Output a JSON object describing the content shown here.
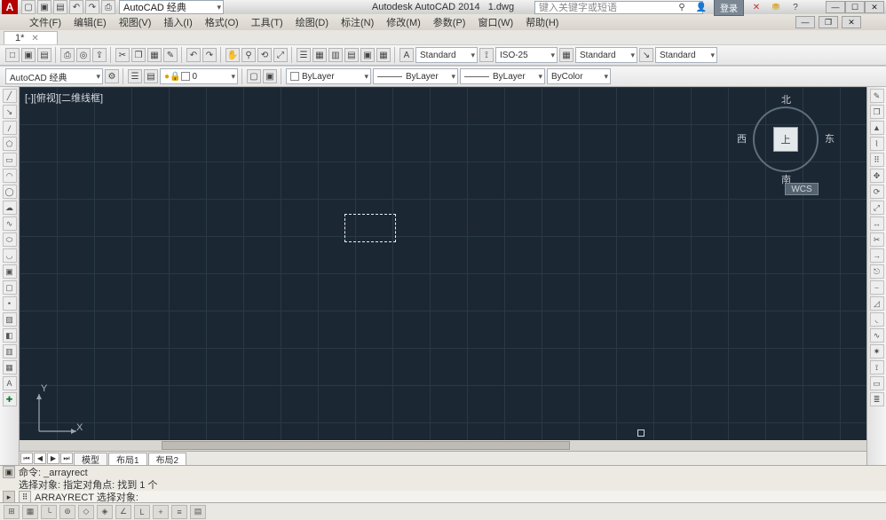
{
  "title_app": "Autodesk AutoCAD 2014",
  "title_doc": "1.dwg",
  "workspace_sel": "AutoCAD 经典",
  "search_placeholder": "键入关键字或短语",
  "login": "登录",
  "menu": [
    "文件(F)",
    "编辑(E)",
    "视图(V)",
    "插入(I)",
    "格式(O)",
    "工具(T)",
    "绘图(D)",
    "标注(N)",
    "修改(M)",
    "参数(P)",
    "窗口(W)",
    "帮助(H)"
  ],
  "doc_tab": "1*",
  "row1": {
    "style1": "Standard",
    "style2": "ISO-25",
    "style3": "Standard",
    "style4": "Standard"
  },
  "row2": {
    "workspace": "AutoCAD 经典",
    "layer": "0",
    "color": "ByLayer",
    "ltype": "ByLayer",
    "lweight": "ByLayer",
    "plot": "ByColor"
  },
  "view_label": "[-][俯视][二维线框]",
  "compass": {
    "n": "北",
    "s": "南",
    "e": "东",
    "w": "西",
    "top": "上",
    "wcs": "WCS"
  },
  "layout_tabs": [
    "模型",
    "布局1",
    "布局2"
  ],
  "ucs": {
    "x": "X",
    "y": "Y"
  },
  "cmd": {
    "l1": "命令:  _arrayrect",
    "l2": "选择对象: 指定对角点: 找到 1 个",
    "prompt": "ARRAYRECT 选择对象:"
  }
}
